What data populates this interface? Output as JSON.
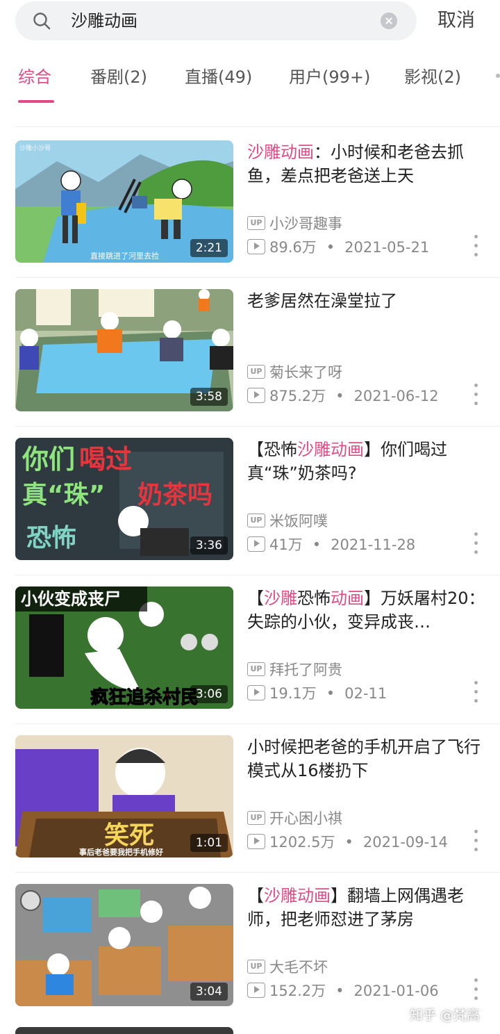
{
  "search": {
    "query": "沙雕动画",
    "cancel_label": "取消"
  },
  "tabs": [
    {
      "label": "综合",
      "active": true
    },
    {
      "label": "番剧(2)",
      "active": false
    },
    {
      "label": "直播(49)",
      "active": false
    },
    {
      "label": "用户(99+)",
      "active": false
    },
    {
      "label": "影视(2)",
      "active": false
    }
  ],
  "videos": [
    {
      "title_parts": [
        {
          "text": "沙雕动画",
          "hl": true
        },
        {
          "text": "：小时候和老爸去抓鱼，差点把老爸送上天",
          "hl": false
        }
      ],
      "uploader": "小沙哥趣事",
      "views": "89.6万",
      "date": "2021-05-21",
      "duration": "2:21",
      "thumb_caption": "直接跳进了河里去捡",
      "thumb_corner": "沙雕小沙哥"
    },
    {
      "title_parts": [
        {
          "text": "老爹居然在澡堂拉了",
          "hl": false
        }
      ],
      "uploader": "菊长来了呀",
      "views": "875.2万",
      "date": "2021-06-12",
      "duration": "3:58",
      "thumb_caption": "",
      "thumb_corner": ""
    },
    {
      "title_parts": [
        {
          "text": "【恐怖",
          "hl": false
        },
        {
          "text": "沙雕动画",
          "hl": true
        },
        {
          "text": "】你们喝过真“珠”奶茶吗?",
          "hl": false
        }
      ],
      "uploader": "米饭阿噗",
      "views": "41万",
      "date": "2021-11-28",
      "duration": "3:36",
      "thumb_text": {
        "line1a": "你们",
        "line1b": "喝过",
        "line2a": "真“珠”",
        "line2b": "奶茶吗",
        "line3": "恐怖"
      }
    },
    {
      "title_parts": [
        {
          "text": "【",
          "hl": false
        },
        {
          "text": "沙雕",
          "hl": true
        },
        {
          "text": "恐怖",
          "hl": false
        },
        {
          "text": "动画",
          "hl": true
        },
        {
          "text": "】万妖屠村20：失踪的小伙，变异成丧…",
          "hl": false
        }
      ],
      "uploader": "拜托了阿贵",
      "views": "19.1万",
      "date": "02-11",
      "duration": "3:06",
      "thumb_text": {
        "top": "小伙变成丧尸",
        "bottom": "疯狂追杀村民"
      }
    },
    {
      "title_parts": [
        {
          "text": "小时候把老爸的手机开启了飞行模式从16楼扔下",
          "hl": false
        }
      ],
      "uploader": "开心困小祺",
      "views": "1202.5万",
      "date": "2021-09-14",
      "duration": "1:01",
      "thumb_text": {
        "big": "笑死",
        "caption": "事后老爸要我把手机修好"
      }
    },
    {
      "title_parts": [
        {
          "text": "【",
          "hl": false
        },
        {
          "text": "沙雕动画",
          "hl": true
        },
        {
          "text": "】翻墙上网偶遇老师，把老师怼进了茅房",
          "hl": false
        }
      ],
      "uploader": "大毛不坏",
      "views": "152.2万",
      "date": "2021-01-06",
      "duration": "3:04"
    }
  ],
  "up_badge": "UP",
  "separator": "•",
  "watermark": "知乎 @梵高",
  "colors": {
    "accent": "#e24a86",
    "muted": "#888888",
    "divider": "#eceef0"
  }
}
